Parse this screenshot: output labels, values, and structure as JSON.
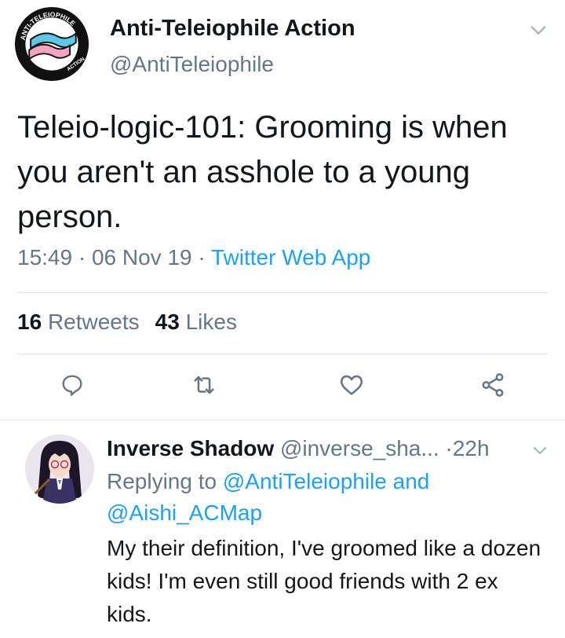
{
  "tweet": {
    "author_name": "Anti-Teleiophile Action",
    "author_handle": "@AntiTeleiophile",
    "text": "Teleio-logic-101: Grooming is when you aren't an asshole to a young person.",
    "time": "15:49",
    "date": "06 Nov 19",
    "separator": "·",
    "source": "Twitter Web App",
    "retweet_count": "16",
    "retweet_label": "Retweets",
    "like_count": "43",
    "like_label": "Likes",
    "avatar_logo_text": "ANTI-TELEIOPHILE ACTION"
  },
  "reply": {
    "author_name": "Inverse Shadow",
    "author_handle": "@inverse_sha...",
    "time": "22h",
    "replying_prefix": "Replying to",
    "mention_1": "@AntiTeleiophile",
    "conjunction": "and",
    "mention_2": "@Aishi_ACMap",
    "text": "My their definition, I've groomed like a dozen kids! I'm even still good friends with 2 ex kids."
  },
  "icons": {
    "actions": [
      "reply-icon",
      "retweet-icon",
      "like-icon",
      "share-icon"
    ],
    "menu": "chevron-down-icon"
  },
  "colors": {
    "accent": "#1da1f2",
    "text_primary": "#14171a",
    "text_secondary": "#657786",
    "divider": "#e1e8ed",
    "logo_pink": "#f4a3c0",
    "logo_blue": "#5bc8e8"
  }
}
